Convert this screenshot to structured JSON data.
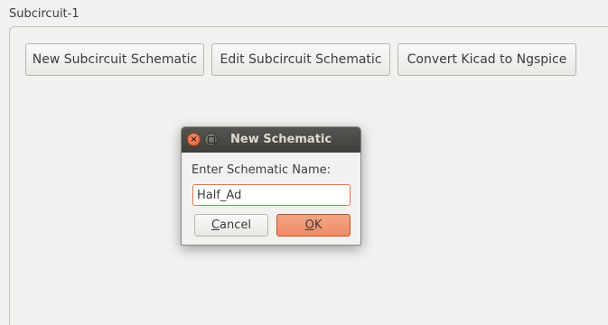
{
  "group": {
    "title": "Subcircuit-1"
  },
  "toolbar": {
    "new_label": "New Subcircuit Schematic",
    "edit_label": "Edit Subcircuit Schematic",
    "convert_label": "Convert Kicad to Ngspice"
  },
  "dialog": {
    "title": "New Schematic",
    "prompt": "Enter Schematic Name:",
    "input_value": "Half_Ad",
    "cancel_mnemonic": "C",
    "cancel_rest": "ancel",
    "ok_mnemonic": "O",
    "ok_rest": "K",
    "close_icon": "close-icon",
    "maximize_icon": "maximize-icon"
  },
  "colors": {
    "accent": "#ee8b63",
    "titlebar": "#3f3e39",
    "background": "#f2f1f0"
  }
}
